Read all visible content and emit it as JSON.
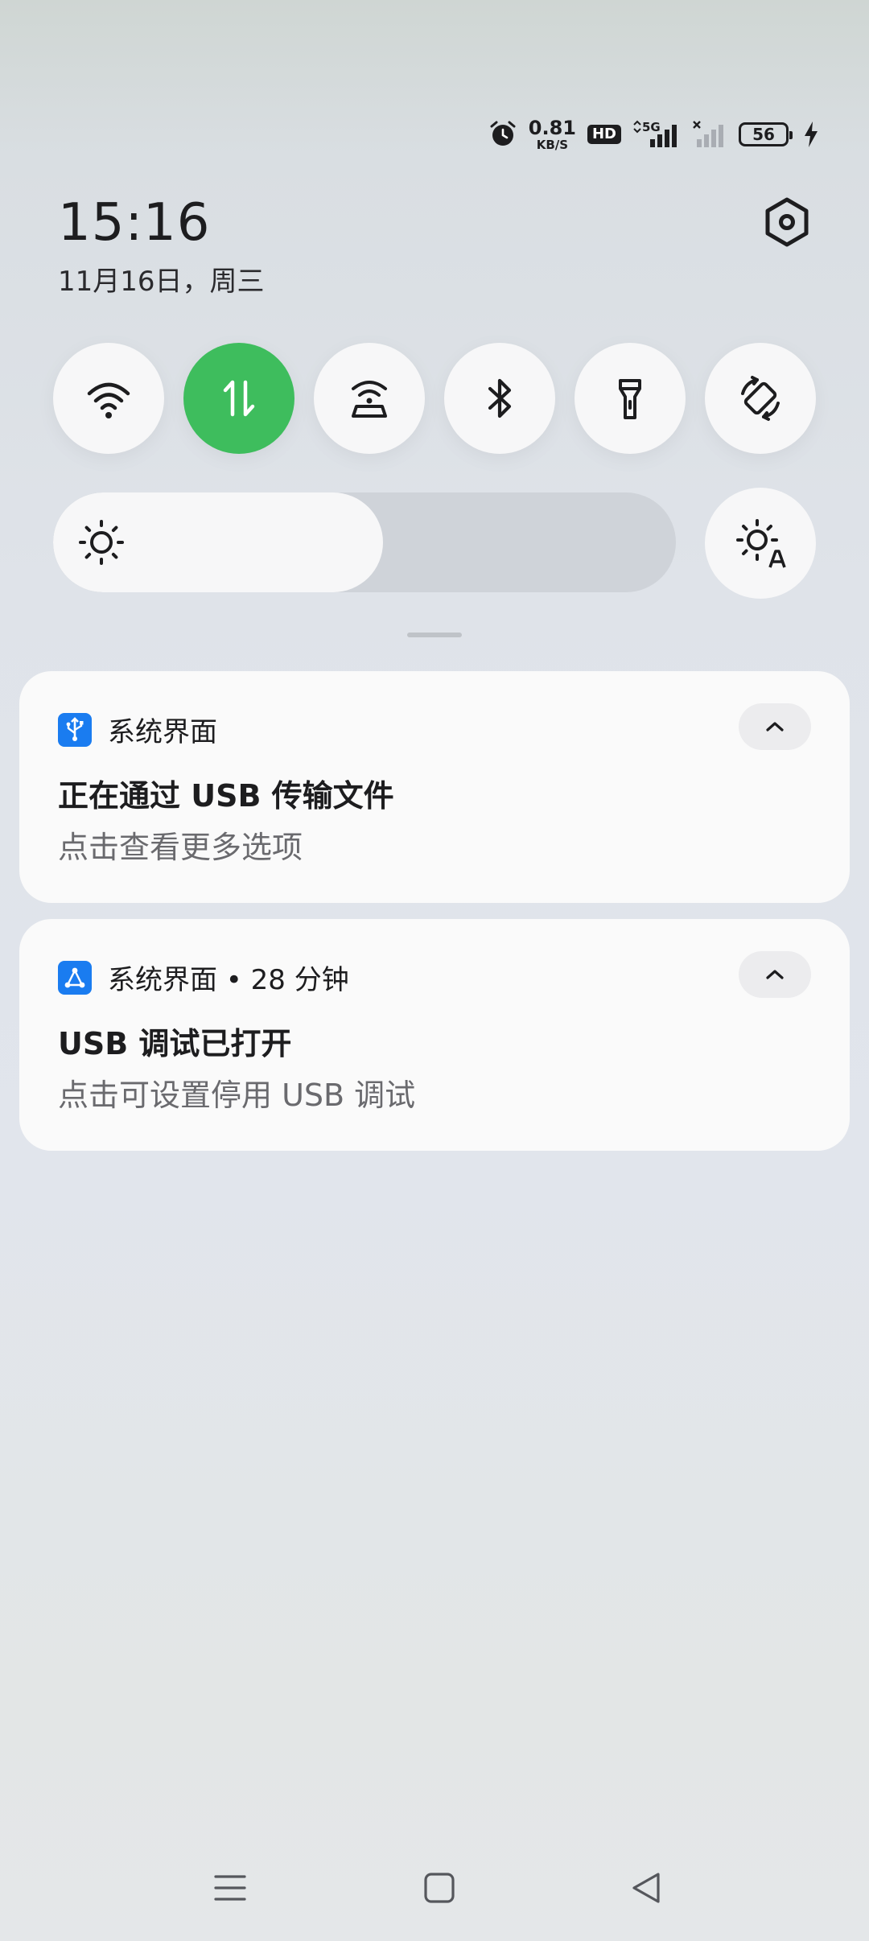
{
  "status_bar": {
    "speed_value": "0.81",
    "speed_unit": "KB/S",
    "hd_label": "HD",
    "network_label": "5G",
    "battery_level": "56",
    "icons": [
      "alarm-icon",
      "hd-icon",
      "signal-5g-icon",
      "signal-nosim-icon",
      "battery-icon",
      "charging-icon"
    ]
  },
  "header": {
    "time": "15:16",
    "date": "11月16日，周三"
  },
  "quick_tiles": [
    {
      "name": "wifi",
      "icon": "wifi-icon",
      "active": false
    },
    {
      "name": "mobile-data",
      "icon": "mobile-data-icon",
      "active": true
    },
    {
      "name": "hotspot",
      "icon": "hotspot-icon",
      "active": false
    },
    {
      "name": "bluetooth",
      "icon": "bluetooth-icon",
      "active": false
    },
    {
      "name": "flashlight",
      "icon": "flashlight-icon",
      "active": false
    },
    {
      "name": "auto-rotate",
      "icon": "auto-rotate-icon",
      "active": false
    }
  ],
  "brightness": {
    "level": 0.53,
    "auto_icon": "auto-brightness-icon"
  },
  "notifications": [
    {
      "app_name": "系统界面",
      "time_meta": "",
      "title": "正在通过 USB 传输文件",
      "description": "点击查看更多选项",
      "icon": "usb-icon"
    },
    {
      "app_name": "系统界面",
      "time_meta": " • 28 分钟",
      "title": "USB 调试已打开",
      "description": "点击可设置停用 USB 调试",
      "icon": "usb-debug-icon"
    }
  ],
  "colors": {
    "accent_green": "#3ebd5d",
    "app_icon_blue": "#1a7cf0"
  }
}
